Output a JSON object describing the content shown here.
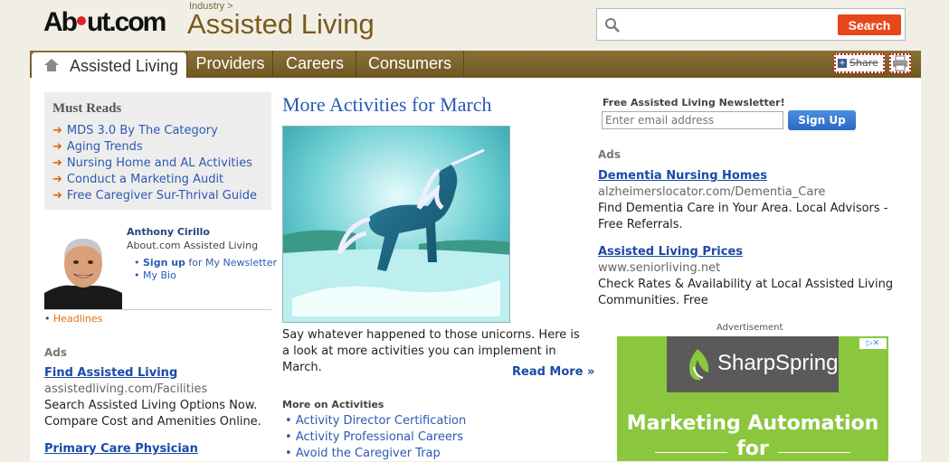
{
  "header": {
    "brand": "About.com",
    "crumb": "Industry >",
    "title": "Assisted Living",
    "search": {
      "placeholder": "",
      "button": "Search"
    }
  },
  "nav": {
    "home": "Assisted Living",
    "tabs": [
      "Providers",
      "Careers",
      "Consumers"
    ],
    "share": "Share"
  },
  "must_reads": {
    "heading": "Must Reads",
    "items": [
      "MDS 3.0 By The Category",
      "Aging Trends",
      "Nursing Home and AL Activities",
      "Conduct a Marketing Audit",
      "Free Caregiver Sur-Thrival Guide"
    ]
  },
  "author": {
    "name": "Anthony Cirillo",
    "site": "About.com Assisted Living",
    "signup_bold": "Sign up",
    "signup_rest": " for My Newsletter",
    "bio": "My Bio",
    "headlines": "Headlines"
  },
  "left_ads": {
    "label": "Ads",
    "items": [
      {
        "title": "Find Assisted Living",
        "url": "assistedliving.com/Facilities",
        "desc": "Search Assisted Living Options Now. Compare Cost and Amenities Online."
      },
      {
        "title": "Primary Care Physician"
      }
    ]
  },
  "article": {
    "title": "More Activities for March",
    "text": "Say whatever happened to those unicorns. Here is a look at more activities you can implement in March.",
    "read_more": "Read More »",
    "more_heading": "More on Activities",
    "more_items": [
      "Activity Director Certification",
      "Activity Professional Careers",
      "Avoid the Caregiver Trap"
    ]
  },
  "newsletter": {
    "heading": "Free Assisted Living Newsletter!",
    "placeholder": "Enter email address",
    "button": "Sign Up"
  },
  "right_ads": {
    "label": "Ads",
    "items": [
      {
        "title": "Dementia Nursing Homes",
        "url": "alzheimerslocator.com/Dementia_Care",
        "desc": "Find Dementia Care in Your Area. Local Advisors - Free Referrals."
      },
      {
        "title": "Assisted Living Prices",
        "url": "www.seniorliving.net",
        "desc": "Check Rates & Availability at Local Assisted Living Communities. Free"
      }
    ]
  },
  "banner": {
    "label": "Advertisement",
    "brand": "SharpSpring",
    "headline": "Marketing Automation",
    "sub": "for"
  },
  "colors": {
    "nav_bar": "#7a6230",
    "link": "#2a5ab5",
    "search_button": "#e8461b",
    "banner_green": "#8ac73e"
  }
}
